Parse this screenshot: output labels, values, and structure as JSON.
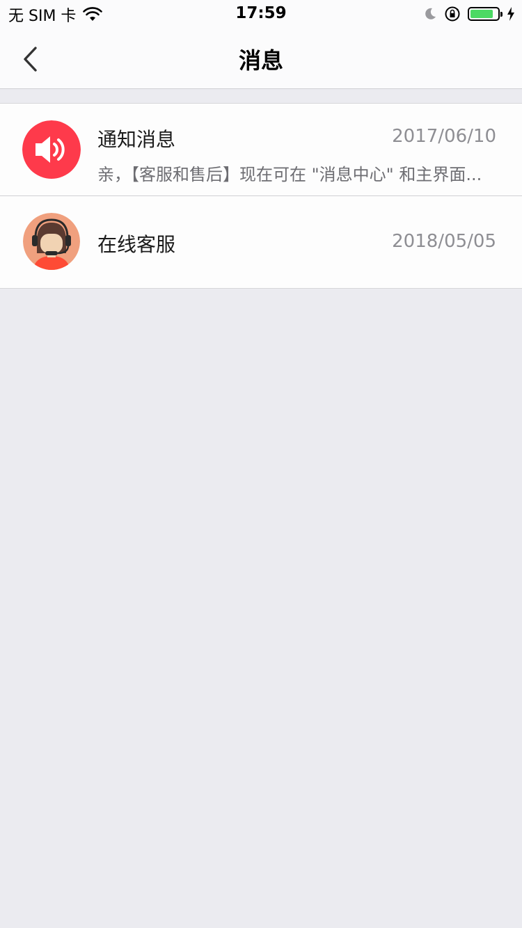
{
  "status_bar": {
    "carrier": "无 SIM 卡",
    "time": "17:59",
    "battery_level": 0.85,
    "battery_color": "#4cd964"
  },
  "nav": {
    "title": "消息",
    "back_icon": "chevron-left-icon"
  },
  "messages": [
    {
      "title": "通知消息",
      "date": "2017/06/10",
      "preview": "亲，【客服和售后】现在可在 \"消息中心\" 和主界面...",
      "icon": "speaker-icon",
      "icon_bg": "#fe3a4b"
    },
    {
      "title": "在线客服",
      "date": "2018/05/05",
      "icon": "customer-service-avatar",
      "icon_bg": "#f0a07e"
    }
  ]
}
